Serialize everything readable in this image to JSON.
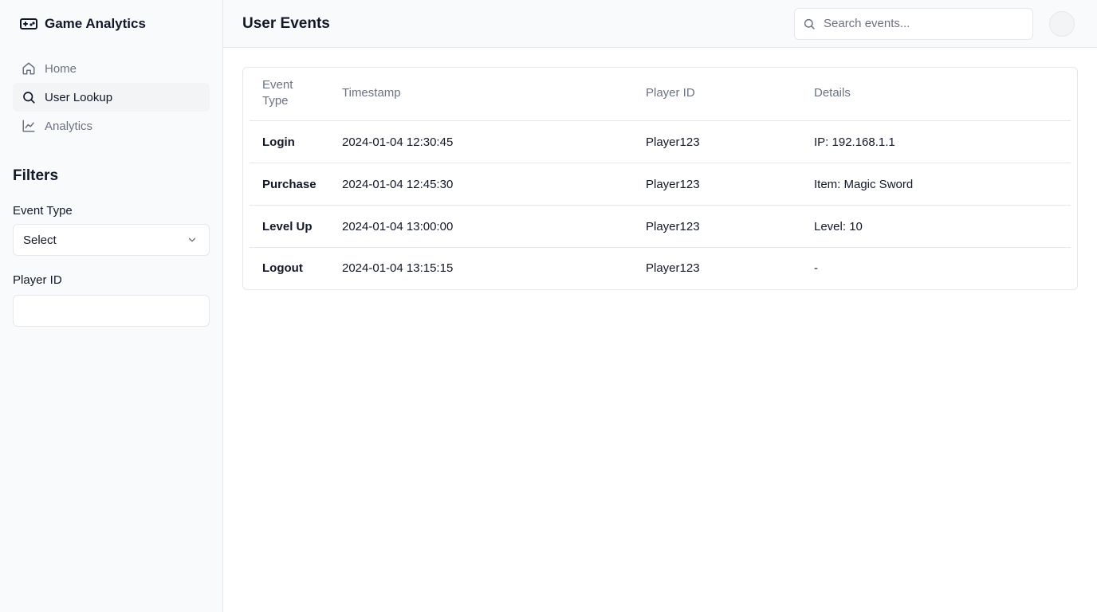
{
  "app": {
    "title": "Game Analytics",
    "logo_icon": "gamepad-icon"
  },
  "sidebar": {
    "nav": [
      {
        "label": "Home",
        "icon": "home-icon",
        "active": false
      },
      {
        "label": "User Lookup",
        "icon": "search-icon",
        "active": true
      },
      {
        "label": "Analytics",
        "icon": "chart-line-icon",
        "active": false
      }
    ],
    "filters": {
      "title": "Filters",
      "event_type": {
        "label": "Event Type",
        "value": "Select"
      },
      "player_id": {
        "label": "Player ID",
        "value": "",
        "placeholder": ""
      }
    }
  },
  "header": {
    "title": "User Events",
    "search": {
      "placeholder": "Search events...",
      "value": ""
    }
  },
  "table": {
    "columns": [
      "Event Type",
      "Timestamp",
      "Player ID",
      "Details"
    ],
    "rows": [
      {
        "type": "Login",
        "timestamp": "2024-01-04 12:30:45",
        "player_id": "Player123",
        "details": "IP: 192.168.1.1"
      },
      {
        "type": "Purchase",
        "timestamp": "2024-01-04 12:45:30",
        "player_id": "Player123",
        "details": "Item: Magic Sword"
      },
      {
        "type": "Level Up",
        "timestamp": "2024-01-04 13:00:00",
        "player_id": "Player123",
        "details": "Level: 10"
      },
      {
        "type": "Logout",
        "timestamp": "2024-01-04 13:15:15",
        "player_id": "Player123",
        "details": "-"
      }
    ]
  },
  "colors": {
    "text_primary": "#111827",
    "text_muted": "#6b7280",
    "border": "#e5e7eb",
    "sidebar_bg": "#f9fafb",
    "active_bg": "#f3f4f6"
  }
}
